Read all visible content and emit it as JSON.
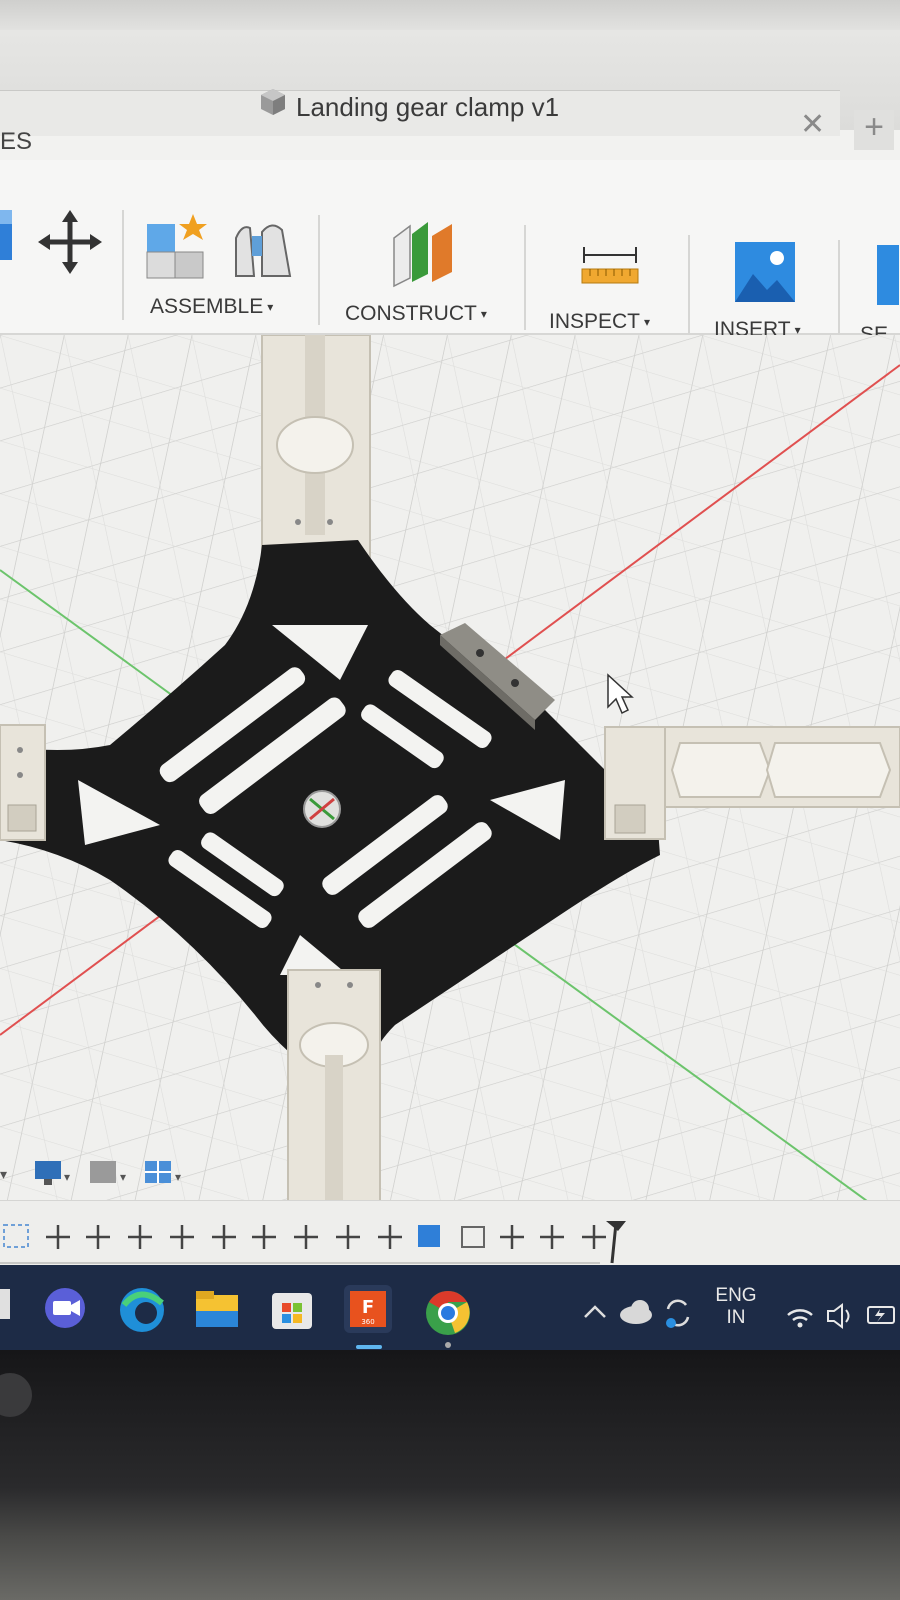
{
  "window": {
    "tab_title": "Landing gear clamp v1",
    "close_symbol": "✕",
    "add_symbol": "+",
    "left_partial_label": "ES"
  },
  "toolbar": {
    "groups": [
      {
        "label": "ASSEMBLE",
        "icon": "assemble-icon"
      },
      {
        "label": "CONSTRUCT",
        "icon": "construct-plane-icon"
      },
      {
        "label": "INSPECT",
        "icon": "measure-ruler-icon"
      },
      {
        "label": "INSERT",
        "icon": "insert-image-icon"
      },
      {
        "label": "SE",
        "icon": "select-icon"
      }
    ],
    "caret": "▾",
    "move_icon": "move-icon",
    "joint_icon": "joint-icon"
  },
  "viewport": {
    "grid_color": "#c8c8c6",
    "axis_x_color": "#e05050",
    "axis_z_color": "#6cc46c",
    "frame_color": "#1b1b1b",
    "arm_color": "#e8e4da"
  },
  "taskbar": {
    "apps": [
      "camera-icon",
      "edge-icon",
      "file-explorer-icon",
      "store-icon",
      "fusion-360-icon",
      "chrome-icon"
    ],
    "fusion_label": "F",
    "fusion_sublabel": "360",
    "language_line1": "ENG",
    "language_line2": "IN"
  }
}
